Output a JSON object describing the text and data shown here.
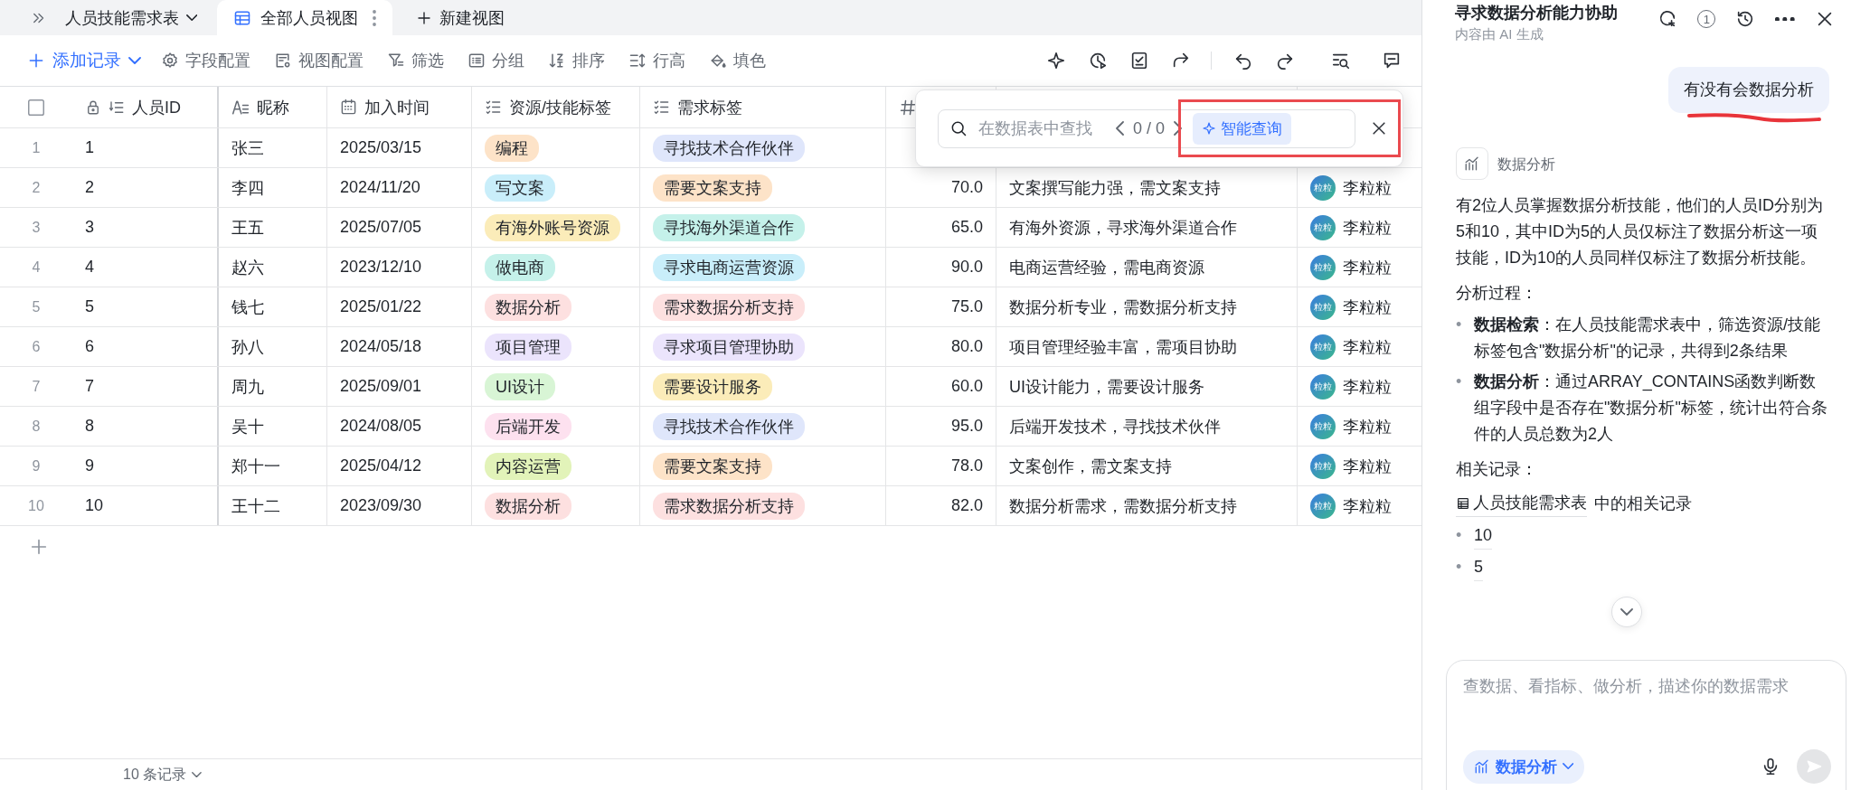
{
  "tab_bar": {
    "table_name": "人员技能需求表",
    "views": [
      {
        "label": "全部人员视图",
        "selected": true
      }
    ],
    "new_view": "新建视图"
  },
  "toolbar": {
    "add_record": "添加记录",
    "actions": [
      {
        "label": "字段配置",
        "kind": "settings"
      },
      {
        "label": "视图配置",
        "kind": "view"
      },
      {
        "label": "筛选",
        "kind": "filter"
      },
      {
        "label": "分组",
        "kind": "group"
      },
      {
        "label": "排序",
        "kind": "sort"
      },
      {
        "label": "行高",
        "kind": "height"
      },
      {
        "label": "填色",
        "kind": "fill"
      }
    ]
  },
  "table": {
    "header_checkbox": {
      "checked": false
    },
    "columns": [
      {
        "label": "人员ID",
        "kind": "autonumber"
      },
      {
        "label": "昵称",
        "kind": "text"
      },
      {
        "label": "加入时间",
        "kind": "date"
      },
      {
        "label": "资源/技能标签",
        "kind": "tags"
      },
      {
        "label": "需求标签",
        "kind": "tags"
      },
      {
        "kind": "number"
      }
    ],
    "rows": [
      {
        "index": "1",
        "id": "1",
        "name": "张三",
        "date": "2025/03/15",
        "skills": [
          {
            "text": "编程",
            "color": "#fde3c8"
          }
        ],
        "needs": [
          {
            "text": "寻找技术合作伙伴",
            "color": "#dfe6fb"
          }
        ]
      },
      {
        "index": "2",
        "id": "2",
        "name": "李四",
        "date": "2024/11/20",
        "skills": [
          {
            "text": "写文案",
            "color": "#c9eefa"
          }
        ],
        "needs": [
          {
            "text": "需要文案支持",
            "color": "#fde3c8"
          }
        ],
        "score": "70.0",
        "note": "文案撰写能力强，需文案支持",
        "owner": {
          "name": "李粒粒",
          "avatar": "粒粒"
        }
      },
      {
        "index": "3",
        "id": "3",
        "name": "王五",
        "date": "2025/07/05",
        "skills": [
          {
            "text": "有海外账号资源",
            "color": "#fbecb9"
          }
        ],
        "needs": [
          {
            "text": "寻找海外渠道合作",
            "color": "#c5f1ea"
          }
        ],
        "score": "65.0",
        "note": "有海外资源，寻求海外渠道合作",
        "owner": {
          "name": "李粒粒",
          "avatar": "粒粒"
        }
      },
      {
        "index": "4",
        "id": "4",
        "name": "赵六",
        "date": "2023/12/10",
        "skills": [
          {
            "text": "做电商",
            "color": "#c5f1ea"
          }
        ],
        "needs": [
          {
            "text": "寻求电商运营资源",
            "color": "#c9eefa"
          }
        ],
        "score": "90.0",
        "note": "电商运营经验，需电商资源",
        "owner": {
          "name": "李粒粒",
          "avatar": "粒粒"
        }
      },
      {
        "index": "5",
        "id": "5",
        "name": "钱七",
        "date": "2025/01/22",
        "skills": [
          {
            "text": "数据分析",
            "color": "#fde0e0"
          }
        ],
        "needs": [
          {
            "text": "需求数据分析支持",
            "color": "#fde0e0"
          }
        ],
        "score": "75.0",
        "note": "数据分析专业，需数据分析支持",
        "owner": {
          "name": "李粒粒",
          "avatar": "粒粒"
        }
      },
      {
        "index": "6",
        "id": "6",
        "name": "孙八",
        "date": "2024/05/18",
        "skills": [
          {
            "text": "项目管理",
            "color": "#ebe4fc"
          }
        ],
        "needs": [
          {
            "text": "寻求项目管理协助",
            "color": "#ebe4fc"
          }
        ],
        "score": "80.0",
        "note": "项目管理经验丰富，需项目协助",
        "owner": {
          "name": "李粒粒",
          "avatar": "粒粒"
        }
      },
      {
        "index": "7",
        "id": "7",
        "name": "周九",
        "date": "2025/09/01",
        "skills": [
          {
            "text": "UI设计",
            "color": "#d8f5d5"
          }
        ],
        "needs": [
          {
            "text": "需要设计服务",
            "color": "#fbecb9"
          }
        ],
        "score": "60.0",
        "note": "UI设计能力，需要设计服务",
        "owner": {
          "name": "李粒粒",
          "avatar": "粒粒"
        }
      },
      {
        "index": "8",
        "id": "8",
        "name": "吴十",
        "date": "2024/08/05",
        "skills": [
          {
            "text": "后端开发",
            "color": "#fde1ef"
          }
        ],
        "needs": [
          {
            "text": "寻找技术合作伙伴",
            "color": "#dfe6fb"
          }
        ],
        "score": "95.0",
        "note": "后端开发技术，寻找技术伙伴",
        "owner": {
          "name": "李粒粒",
          "avatar": "粒粒"
        }
      },
      {
        "index": "9",
        "id": "9",
        "name": "郑十一",
        "date": "2025/04/12",
        "skills": [
          {
            "text": "内容运营",
            "color": "#e2f3b9"
          }
        ],
        "needs": [
          {
            "text": "需要文案支持",
            "color": "#fde3c8"
          }
        ],
        "score": "78.0",
        "note": "文案创作，需文案支持",
        "owner": {
          "name": "李粒粒",
          "avatar": "粒粒"
        }
      },
      {
        "index": "10",
        "id": "10",
        "name": "王十二",
        "date": "2023/09/30",
        "skills": [
          {
            "text": "数据分析",
            "color": "#fde0e0"
          }
        ],
        "needs": [
          {
            "text": "需求数据分析支持",
            "color": "#fde0e0"
          }
        ],
        "score": "82.0",
        "note": "数据分析需求，需数据分析支持",
        "owner": {
          "name": "李粒粒",
          "avatar": "粒粒"
        }
      }
    ]
  },
  "search_popup": {
    "placeholder": "在数据表中查找",
    "counter": "0 / 0",
    "smart_query": "智能查询"
  },
  "footer": {
    "record_count": "10 条记录"
  },
  "assistant_panel": {
    "title": "寻求数据分析能力协助",
    "subtitle": "内容由 AI 生成",
    "badge": "1",
    "user_message": "有没有会数据分析",
    "tool": "数据分析",
    "summary": "有2位人员掌握数据分析技能，他们的人员ID分别为5和10，其中ID为5的人员仅标注了数据分析这一项技能，ID为10的人员同样仅标注了数据分析技能。",
    "process_heading": "分析过程：",
    "steps": [
      {
        "marker": "•",
        "text": "**数据检索**：在人员技能需求表中，筛选资源/技能标签包含\"数据分析\"的记录，共得到2条结果"
      },
      {
        "marker": "•",
        "text": "**数据分析**：通过ARRAY_CONTAINS函数判断数组字段中是否存在\"数据分析\"标签，统计出符合条件的人员总数为2人"
      }
    ],
    "records_heading": "相关记录：",
    "record_table": "人员技能需求表",
    "record_suffix": "中的相关记录",
    "records": [
      {
        "marker": "•",
        "text": "10"
      },
      {
        "marker": "•",
        "text": "5"
      }
    ],
    "input": {
      "placeholder": "查数据、看指标、做分析，描述你的数据需求",
      "mode": "数据分析"
    }
  }
}
